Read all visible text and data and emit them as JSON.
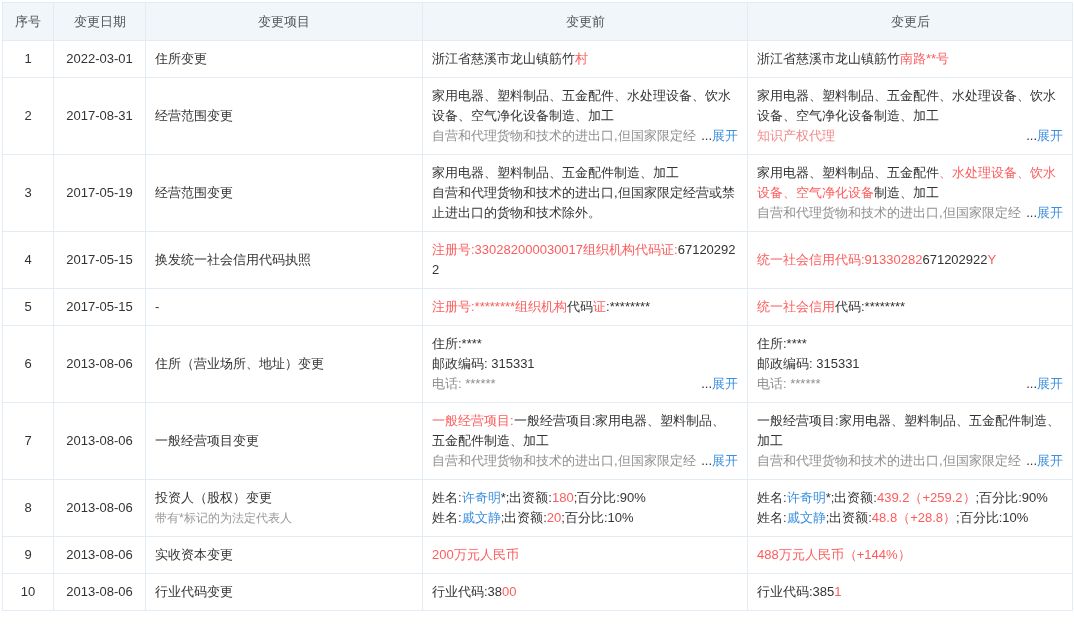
{
  "table": {
    "columns": [
      "序号",
      "变更日期",
      "变更项目",
      "变更前",
      "变更后"
    ],
    "rows": [
      {
        "no": "1",
        "date": "2022-03-01",
        "item": "住所变更",
        "before": {
          "lines": [
            [
              {
                "text": "浙江省慈溪市龙山镇筋竹",
                "highlighted": false,
                "link": false
              },
              {
                "text": "村",
                "highlighted": true,
                "link": false
              }
            ]
          ]
        },
        "after": {
          "lines": [
            [
              {
                "text": "浙江省慈溪市龙山镇筋竹",
                "highlighted": false,
                "link": false
              },
              {
                "text": "南路**号",
                "highlighted": true,
                "link": false
              }
            ]
          ]
        }
      },
      {
        "no": "2",
        "date": "2017-08-31",
        "item": "经营范围变更",
        "before": {
          "lines": [
            [
              {
                "text": "家用电器、塑料制品、五金配件、水处理设备、饮水设备、空气净化设备制造、加工",
                "highlighted": false,
                "link": false
              }
            ]
          ],
          "faded": {
            "text": "自营和代理货物和技术的进出口,但国家限定经",
            "highlighted": false
          },
          "more": {
            "ellipsis": "...",
            "label": "展开"
          }
        },
        "after": {
          "lines": [
            [
              {
                "text": "家用电器、塑料制品、五金配件、水处理设备、饮水设备、空气净化设备制造、加工",
                "highlighted": false,
                "link": false
              }
            ]
          ],
          "faded": {
            "text": "知识产权代理",
            "highlighted": true
          },
          "more": {
            "ellipsis": "...",
            "label": "展开"
          }
        }
      },
      {
        "no": "3",
        "date": "2017-05-19",
        "item": "经营范围变更",
        "before": {
          "lines": [
            [
              {
                "text": "家用电器、塑料制品、五金配件制造、加工",
                "highlighted": false,
                "link": false
              }
            ],
            [
              {
                "text": "自营和代理货物和技术的进出口,但国家限定经营或禁止进出口的货物和技术除外。",
                "highlighted": false,
                "link": false
              }
            ]
          ]
        },
        "after": {
          "lines": [
            [
              {
                "text": "家用电器、塑料制品、五金配件",
                "highlighted": false,
                "link": false
              },
              {
                "text": "、水处理设备、饮水设备、空气净化设备",
                "highlighted": true,
                "link": false
              },
              {
                "text": "制造、加工",
                "highlighted": false,
                "link": false
              }
            ]
          ],
          "faded": {
            "text": "自营和代理货物和技术的进出口,但国家限定经",
            "highlighted": false
          },
          "more": {
            "ellipsis": "...",
            "label": "展开"
          }
        }
      },
      {
        "no": "4",
        "date": "2017-05-15",
        "item": "换发统一社会信用代码执照",
        "before": {
          "lines": [
            [
              {
                "text": "注册号:330282000030017组织机构代码证:",
                "highlighted": true,
                "link": false
              },
              {
                "text": "671202922",
                "highlighted": false,
                "link": false
              }
            ]
          ]
        },
        "after": {
          "lines": [
            [
              {
                "text": "统一社会信用代码:91330282",
                "highlighted": true,
                "link": false
              },
              {
                "text": "671202922",
                "highlighted": false,
                "link": false
              },
              {
                "text": "Y",
                "highlighted": true,
                "link": false
              }
            ]
          ]
        }
      },
      {
        "no": "5",
        "date": "2017-05-15",
        "item": "-",
        "before": {
          "lines": [
            [
              {
                "text": "注册号:********组织机构",
                "highlighted": true,
                "link": false
              },
              {
                "text": "代码",
                "highlighted": false,
                "link": false
              },
              {
                "text": "证",
                "highlighted": true,
                "link": false
              },
              {
                "text": ":********",
                "highlighted": false,
                "link": false
              }
            ]
          ]
        },
        "after": {
          "lines": [
            [
              {
                "text": "统一社会信用",
                "highlighted": true,
                "link": false
              },
              {
                "text": "代码:********",
                "highlighted": false,
                "link": false
              }
            ]
          ]
        }
      },
      {
        "no": "6",
        "date": "2013-08-06",
        "item": "住所（营业场所、地址）变更",
        "before": {
          "lines": [
            [
              {
                "text": "住所:****",
                "highlighted": false,
                "link": false
              }
            ],
            [
              {
                "text": "邮政编码: 315331",
                "highlighted": false,
                "link": false
              }
            ]
          ],
          "faded": {
            "text": "电话: ******",
            "highlighted": false
          },
          "more": {
            "ellipsis": "...",
            "label": "展开"
          }
        },
        "after": {
          "lines": [
            [
              {
                "text": "住所:****",
                "highlighted": false,
                "link": false
              }
            ],
            [
              {
                "text": "邮政编码: 315331",
                "highlighted": false,
                "link": false
              }
            ]
          ],
          "faded": {
            "text": "电话: ******",
            "highlighted": false
          },
          "more": {
            "ellipsis": "...",
            "label": "展开"
          }
        }
      },
      {
        "no": "7",
        "date": "2013-08-06",
        "item": "一般经营项目变更",
        "before": {
          "lines": [
            [
              {
                "text": "一般经营项目:",
                "highlighted": true,
                "link": false
              },
              {
                "text": "一般经营项目:家用电器、塑料制品、五金配件制造、加工",
                "highlighted": false,
                "link": false
              }
            ]
          ],
          "faded": {
            "text": "自营和代理货物和技术的进出口,但国家限定经",
            "highlighted": false
          },
          "more": {
            "ellipsis": "...",
            "label": "展开"
          }
        },
        "after": {
          "lines": [
            [
              {
                "text": "一般经营项目:家用电器、塑料制品、五金配件制造、加工",
                "highlighted": false,
                "link": false
              }
            ]
          ],
          "faded": {
            "text": "自营和代理货物和技术的进出口,但国家限定经",
            "highlighted": false
          },
          "more": {
            "ellipsis": "...",
            "label": "展开"
          }
        }
      },
      {
        "no": "8",
        "date": "2013-08-06",
        "item": "投资人（股权）变更",
        "note": "带有*标记的为法定代表人",
        "before": {
          "lines": [
            [
              {
                "text": "姓名:",
                "highlighted": false,
                "link": false
              },
              {
                "text": "许奇明",
                "highlighted": false,
                "link": true
              },
              {
                "text": "*;出资额:",
                "highlighted": false,
                "link": false
              },
              {
                "text": "180",
                "highlighted": true,
                "link": false
              },
              {
                "text": ";百分比:90%",
                "highlighted": false,
                "link": false
              }
            ],
            [
              {
                "text": "姓名:",
                "highlighted": false,
                "link": false
              },
              {
                "text": "戚文静",
                "highlighted": false,
                "link": true
              },
              {
                "text": ";出资额:",
                "highlighted": false,
                "link": false
              },
              {
                "text": "20",
                "highlighted": true,
                "link": false
              },
              {
                "text": ";百分比:10%",
                "highlighted": false,
                "link": false
              }
            ]
          ]
        },
        "after": {
          "lines": [
            [
              {
                "text": "姓名:",
                "highlighted": false,
                "link": false
              },
              {
                "text": "许奇明",
                "highlighted": false,
                "link": true
              },
              {
                "text": "*;出资额:",
                "highlighted": false,
                "link": false
              },
              {
                "text": "439.2（+259.2）",
                "highlighted": true,
                "link": false
              },
              {
                "text": ";百分比:90%",
                "highlighted": false,
                "link": false
              }
            ],
            [
              {
                "text": "姓名:",
                "highlighted": false,
                "link": false
              },
              {
                "text": "戚文静",
                "highlighted": false,
                "link": true
              },
              {
                "text": ";出资额:",
                "highlighted": false,
                "link": false
              },
              {
                "text": "48.8（+28.8）",
                "highlighted": true,
                "link": false
              },
              {
                "text": ";百分比:10%",
                "highlighted": false,
                "link": false
              }
            ]
          ]
        }
      },
      {
        "no": "9",
        "date": "2013-08-06",
        "item": "实收资本变更",
        "before": {
          "lines": [
            [
              {
                "text": "200万元人民币",
                "highlighted": true,
                "link": false
              }
            ]
          ]
        },
        "after": {
          "lines": [
            [
              {
                "text": "488万元人民币（+144%）",
                "highlighted": true,
                "link": false
              }
            ]
          ]
        }
      },
      {
        "no": "10",
        "date": "2013-08-06",
        "item": "行业代码变更",
        "before": {
          "lines": [
            [
              {
                "text": "行业代码:38",
                "highlighted": false,
                "link": false
              },
              {
                "text": "00",
                "highlighted": true,
                "link": false
              }
            ]
          ]
        },
        "after": {
          "lines": [
            [
              {
                "text": "行业代码:385",
                "highlighted": false,
                "link": false
              },
              {
                "text": "1",
                "highlighted": true,
                "link": false
              }
            ]
          ]
        }
      }
    ]
  }
}
